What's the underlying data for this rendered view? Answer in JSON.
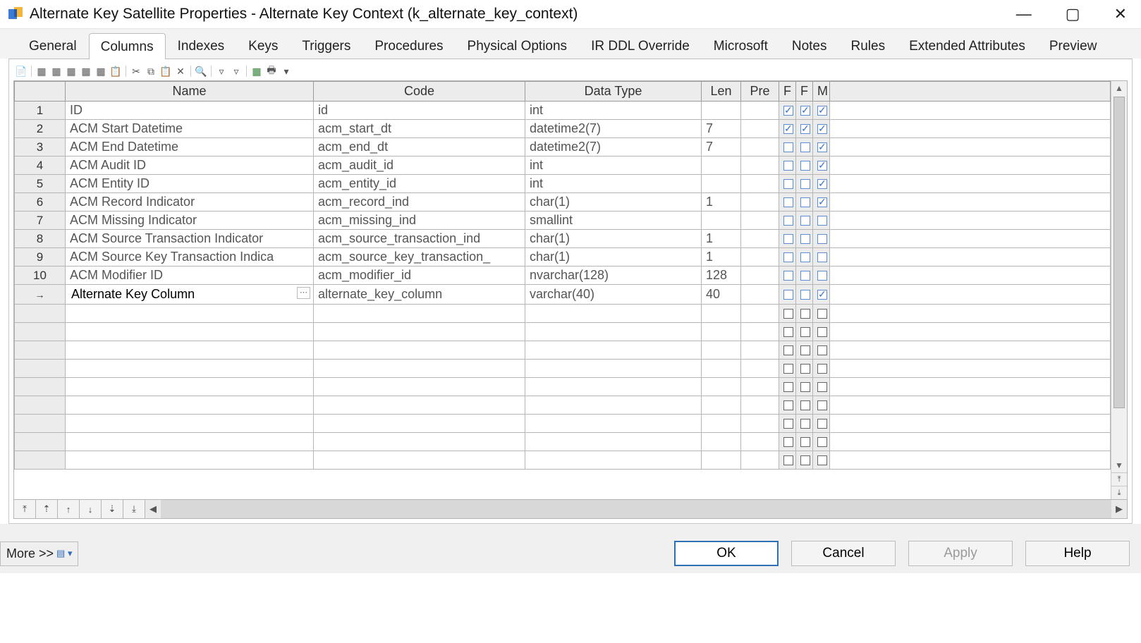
{
  "window": {
    "title": "Alternate Key Satellite Properties - Alternate Key Context (k_alternate_key_context)"
  },
  "tabs": [
    "General",
    "Columns",
    "Indexes",
    "Keys",
    "Triggers",
    "Procedures",
    "Physical Options",
    "IR DDL Override",
    "Microsoft",
    "Notes",
    "Rules",
    "Extended Attributes",
    "Preview"
  ],
  "active_tab": 1,
  "grid": {
    "headers": {
      "row": "",
      "name": "Name",
      "code": "Code",
      "type": "Data Type",
      "len": "Len",
      "pre": "Pre",
      "f1": "F",
      "f2": "F",
      "m": "M"
    },
    "rows": [
      {
        "n": "1",
        "name": "ID",
        "code": "id",
        "type": "int",
        "len": "",
        "pre": "",
        "f1": true,
        "f2": true,
        "m": true
      },
      {
        "n": "2",
        "name": "ACM Start Datetime",
        "code": "acm_start_dt",
        "type": "datetime2(7)",
        "len": "7",
        "pre": "",
        "f1": true,
        "f2": true,
        "m": true
      },
      {
        "n": "3",
        "name": "ACM End Datetime",
        "code": "acm_end_dt",
        "type": "datetime2(7)",
        "len": "7",
        "pre": "",
        "f1": false,
        "f2": false,
        "m": true
      },
      {
        "n": "4",
        "name": "ACM Audit ID",
        "code": "acm_audit_id",
        "type": "int",
        "len": "",
        "pre": "",
        "f1": false,
        "f2": false,
        "m": true
      },
      {
        "n": "5",
        "name": "ACM Entity ID",
        "code": "acm_entity_id",
        "type": "int",
        "len": "",
        "pre": "",
        "f1": false,
        "f2": false,
        "m": true
      },
      {
        "n": "6",
        "name": "ACM Record Indicator",
        "code": "acm_record_ind",
        "type": "char(1)",
        "len": "1",
        "pre": "",
        "f1": false,
        "f2": false,
        "m": true
      },
      {
        "n": "7",
        "name": "ACM Missing Indicator",
        "code": "acm_missing_ind",
        "type": "smallint",
        "len": "",
        "pre": "",
        "f1": false,
        "f2": false,
        "m": false
      },
      {
        "n": "8",
        "name": "ACM Source Transaction Indicator",
        "code": "acm_source_transaction_ind",
        "type": "char(1)",
        "len": "1",
        "pre": "",
        "f1": false,
        "f2": false,
        "m": false
      },
      {
        "n": "9",
        "name": "ACM Source Key Transaction Indica",
        "code": "acm_source_key_transaction_",
        "type": "char(1)",
        "len": "1",
        "pre": "",
        "f1": false,
        "f2": false,
        "m": false
      },
      {
        "n": "10",
        "name": "ACM Modifier ID",
        "code": "acm_modifier_id",
        "type": "nvarchar(128)",
        "len": "128",
        "pre": "",
        "f1": false,
        "f2": false,
        "m": false
      },
      {
        "n": "",
        "name": "Alternate Key Column",
        "code": "alternate_key_column",
        "type": "varchar(40)",
        "len": "40",
        "pre": "",
        "f1": false,
        "f2": false,
        "m": true,
        "editing": true
      }
    ],
    "blank_rows": 9
  },
  "footer": {
    "more": "More >>",
    "ok": "OK",
    "cancel": "Cancel",
    "apply": "Apply",
    "help": "Help"
  }
}
